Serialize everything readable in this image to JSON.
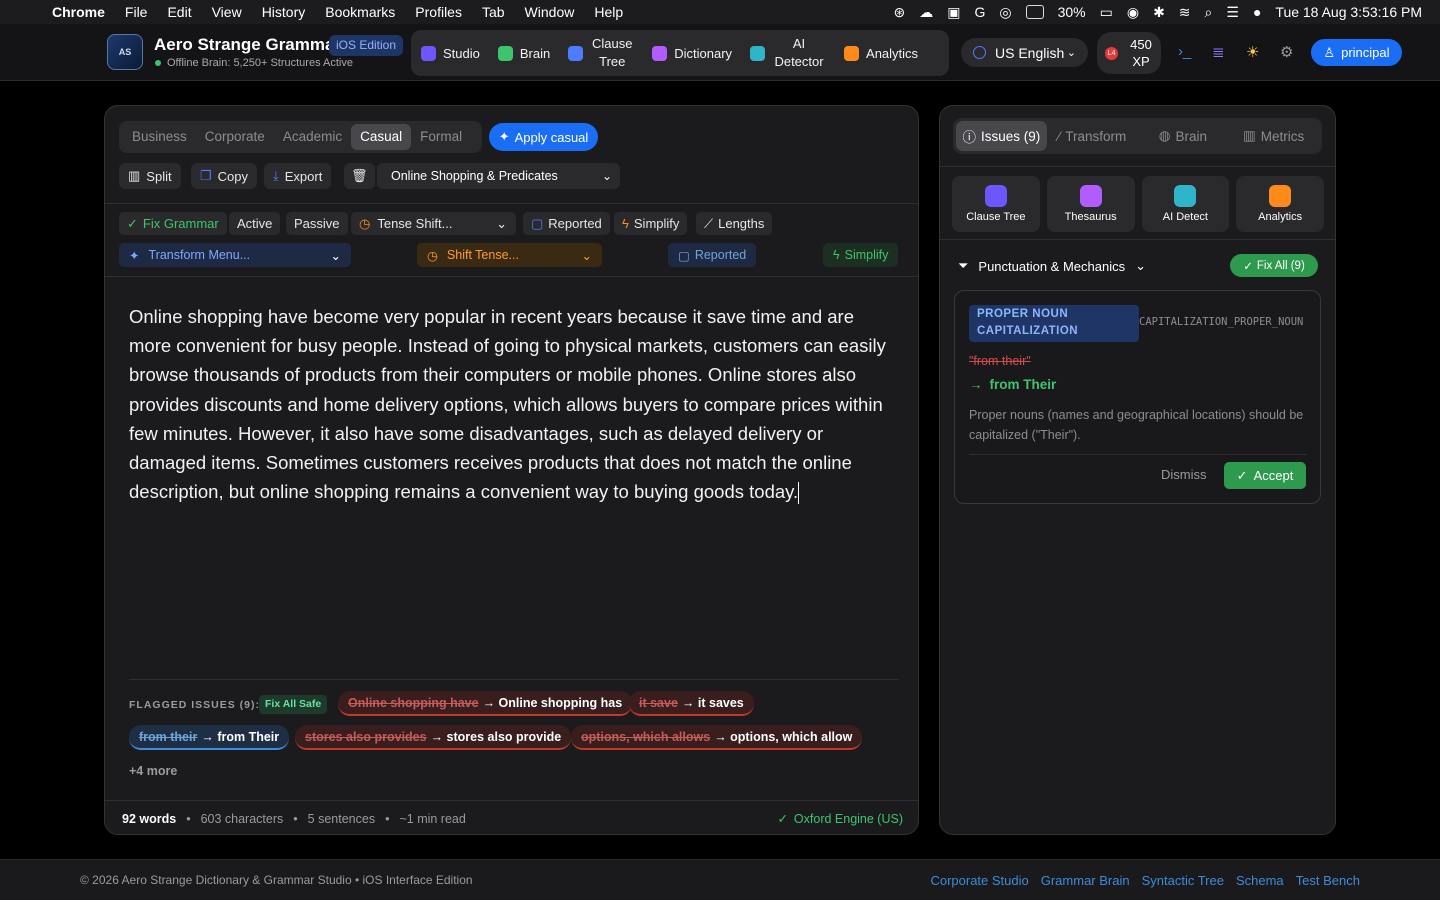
{
  "menubar": {
    "app": "Chrome",
    "items": [
      "File",
      "Edit",
      "View",
      "History",
      "Bookmarks",
      "Profiles",
      "Tab",
      "Window",
      "Help"
    ],
    "battery": "30%",
    "clock": "Tue 18 Aug  3:53:16 PM"
  },
  "header": {
    "title": "Aero Strange Grammar",
    "edition": "iOS Edition",
    "brain_status": "Offline Brain: 5,250+ Structures Active",
    "nav": [
      {
        "label": "Studio",
        "icon": "sparkles-icon",
        "color": "#6e56ff"
      },
      {
        "label": "Brain",
        "icon": "brain-icon",
        "color": "#3ec46d"
      },
      {
        "label": "Clause Tree",
        "icon": "tree-icon",
        "color": "#4d7cff"
      },
      {
        "label": "Dictionary",
        "icon": "book-icon",
        "color": "#b05cff"
      },
      {
        "label": "AI Detector",
        "icon": "robot-icon",
        "color": "#2fb5c9"
      },
      {
        "label": "Analytics",
        "icon": "bar-chart-icon",
        "color": "#ff8a1a"
      }
    ],
    "language": "US English",
    "level": "L4",
    "xp": "450 XP",
    "user": "principal"
  },
  "editor": {
    "tones": [
      "Business",
      "Corporate",
      "Academic",
      "Casual",
      "Formal"
    ],
    "active_tone": "Casual",
    "apply_label": "Apply casual",
    "toolbar": {
      "split": "Split",
      "copy": "Copy",
      "export": "Export",
      "preset": "Online Shopping & Predicates"
    },
    "actions": {
      "fix": "Fix Grammar",
      "active": "Active",
      "passive": "Passive",
      "tense": "Tense Shift...",
      "reported": "Reported",
      "simplify": "Simplify",
      "lengths": "Lengths"
    },
    "actions2": {
      "transform": "Transform Menu...",
      "shift": "Shift Tense...",
      "reported": "Reported",
      "simplify": "Simplify"
    },
    "text": "Online shopping have become very popular in recent years because it save time and are more convenient for busy people. Instead of going to physical markets, customers can easily browse thousands of products from their computers or mobile phones. Online stores also provides discounts and home delivery options, which allows buyers to compare prices within few minutes. However, it also have some disadvantages, such as delayed delivery or damaged items. Sometimes customers receives products that does not match the online description, but online shopping remains a convenient way to buying goods today.",
    "flagged_title": "FLAGGED ISSUES (9):",
    "fix_all_safe": "Fix All Safe",
    "flags": [
      {
        "old": "Online shopping have",
        "new": "→ Online shopping has"
      },
      {
        "old": "it save",
        "new": "→ it saves"
      },
      {
        "old": "from their",
        "new": "→ from Their"
      },
      {
        "old": "stores also provides",
        "new": "→ stores also provide"
      },
      {
        "old": "options, which allows",
        "new": "→ options, which allow"
      }
    ],
    "more": "+4 more",
    "status": {
      "words": "92 words",
      "chars": "603 characters",
      "sentences": "5 sentences",
      "read": "~1 min read",
      "engine": "Oxford Engine (US)"
    }
  },
  "sidebar": {
    "tabs": [
      "Issues (9)",
      "Transform",
      "Brain",
      "Metrics"
    ],
    "tools": [
      {
        "label": "Clause Tree",
        "color": "#6e56ff"
      },
      {
        "label": "Thesaurus",
        "color": "#b05cff"
      },
      {
        "label": "AI Detect",
        "color": "#2fb5c9"
      },
      {
        "label": "Analytics",
        "color": "#ff8a1a"
      }
    ],
    "category": "Punctuation & Mechanics",
    "fix_all": "Fix All (9)",
    "issue": {
      "badge": "PROPER NOUN CAPITALIZATION",
      "code": "CAPITALIZATION_PROPER_NOUN",
      "old": "\"from their\"",
      "new": "from Their",
      "description": "Proper nouns (names and geographical locations) should be capitalized (\"Their\").",
      "dismiss": "Dismiss",
      "accept": "Accept"
    }
  },
  "footer": {
    "copyright": "© 2026 Aero Strange Dictionary & Grammar Studio • iOS Interface Edition",
    "links": [
      "Corporate Studio",
      "Grammar Brain",
      "Syntactic Tree",
      "Schema",
      "Test Bench"
    ]
  }
}
